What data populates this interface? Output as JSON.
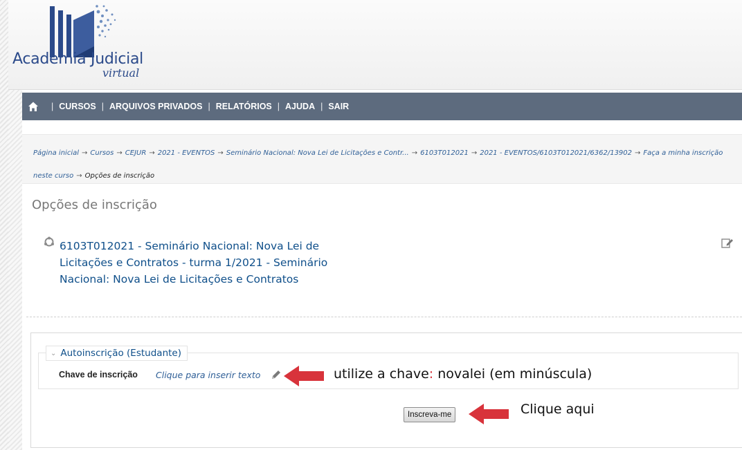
{
  "header": {
    "logo_text": "Academia Judicial",
    "logo_sub": "virtual"
  },
  "navbar": {
    "home_icon": "home-icon",
    "items": [
      "CURSOS",
      "ARQUIVOS PRIVADOS",
      "RELATÓRIOS",
      "AJUDA",
      "SAIR"
    ]
  },
  "breadcrumb": {
    "items": [
      "Página inicial",
      "Cursos",
      "CEJUR",
      "2021 - EVENTOS",
      "Seminário Nacional: Nova Lei de Licitações e Contr...",
      "6103T012021",
      "2021 - EVENTOS/6103T012021/6362/13902",
      "Faça a minha inscrição neste curso"
    ],
    "current": "Opções de inscrição"
  },
  "page": {
    "title": "Opções de inscrição"
  },
  "course": {
    "title": "6103T012021 - Seminário Nacional: Nova Lei de Licitações e Contratos - turma 1/2021 - Seminário Nacional: Nova Lei de Licitações e Contratos"
  },
  "enrolment": {
    "legend": "Autoinscrição (Estudante)",
    "key_label": "Chave de inscrição",
    "key_link": "Clique para inserir texto",
    "button_label": "Inscreva-me"
  },
  "annotations": {
    "note_key_prefix": "utilize a chave",
    "note_key_colon": ":",
    "note_key_suffix": " novalei (em minúscula)",
    "note_click": "Clique aqui"
  },
  "colors": {
    "navbar": "#5d6b7e",
    "link": "#0f4f8a",
    "annotation_arrow": "#d8333b"
  }
}
